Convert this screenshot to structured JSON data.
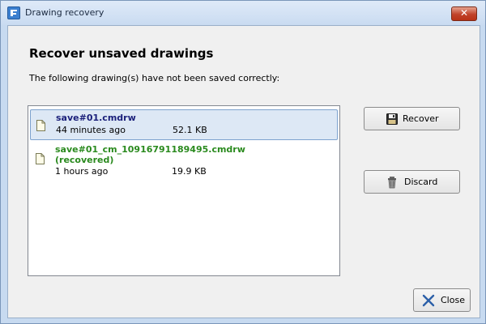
{
  "window": {
    "title": "Drawing recovery",
    "close_glyph": "✕"
  },
  "content": {
    "heading": "Recover unsaved drawings",
    "description": "The following drawing(s) have not been saved correctly:"
  },
  "files": [
    {
      "name": "save#01.cmdrw",
      "age": "44 minutes ago",
      "size": "52.1 KB",
      "selected": true
    },
    {
      "name": "save#01_cm_10916791189495.cmdrw",
      "status": "(recovered)",
      "age": "1 hours ago",
      "size": "19.9 KB",
      "selected": false
    }
  ],
  "buttons": {
    "recover": "Recover",
    "discard": "Discard",
    "close": "Close"
  },
  "icons": {
    "app": "drawing-app-icon",
    "file": "document-icon",
    "recover": "floppy-disk-icon",
    "discard": "trash-can-icon",
    "close": "close-x-icon"
  },
  "colors": {
    "selected_name": "#1a1f7a",
    "recovered_name": "#2a8a1e",
    "selection_bg": "#dde8f5"
  }
}
